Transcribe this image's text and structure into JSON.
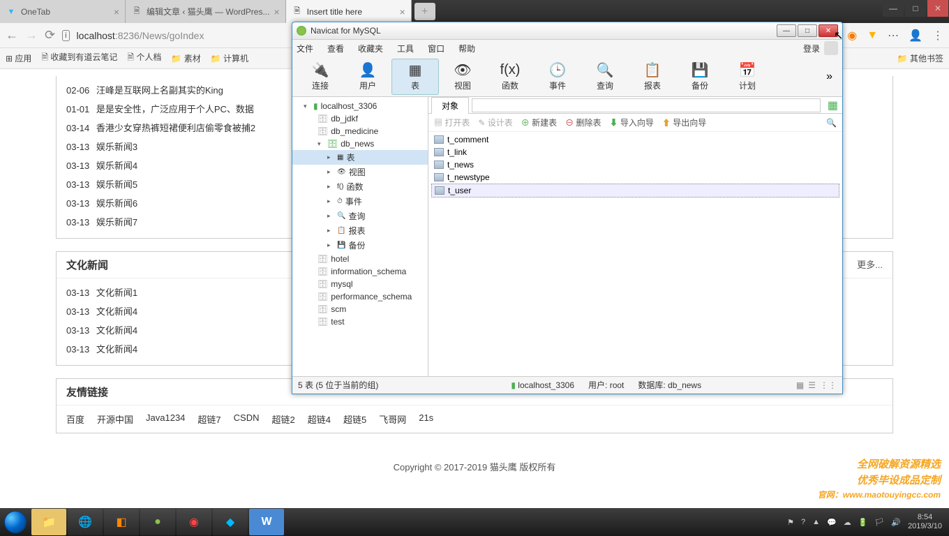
{
  "browser": {
    "tabs": [
      {
        "title": "OneTab",
        "favicon": "▼"
      },
      {
        "title": "编辑文章 ‹ 猫头鹰 — WordPres...",
        "favicon": "🗎"
      },
      {
        "title": "Insert title here",
        "favicon": "🗎"
      }
    ],
    "url_host": "localhost",
    "url_port": ":8236",
    "url_path": "/News/goIndex",
    "bookmarks": [
      "应用",
      "收藏到有道云笔记",
      "个人档",
      "素材",
      "计算机",
      "其他书签"
    ]
  },
  "page": {
    "news1": [
      {
        "date": "02-06",
        "title": "汪峰是互联网上名副其实的King"
      },
      {
        "date": "01-01",
        "title": "是是安全性，广泛应用于个人PC、数据"
      },
      {
        "date": "03-14",
        "title": "香港少女穿热裤短裙便利店偷零食被捕2"
      },
      {
        "date": "03-13",
        "title": "娱乐新闻3"
      },
      {
        "date": "03-13",
        "title": "娱乐新闻4"
      },
      {
        "date": "03-13",
        "title": "娱乐新闻5"
      },
      {
        "date": "03-13",
        "title": "娱乐新闻6"
      },
      {
        "date": "03-13",
        "title": "娱乐新闻7"
      }
    ],
    "section2_title": "文化新闻",
    "section2_more": "更多...",
    "news2": [
      {
        "date": "03-13",
        "title": "文化新闻1"
      },
      {
        "date": "03-13",
        "title": "文化新闻4"
      },
      {
        "date": "03-13",
        "title": "文化新闻4"
      },
      {
        "date": "03-13",
        "title": "文化新闻4"
      }
    ],
    "section3_title": "友情链接",
    "links": [
      "百度",
      "开源中国",
      "Java1234",
      "超链7",
      "CSDN",
      "超链2",
      "超链4",
      "超链5",
      "飞哥网",
      "21s"
    ],
    "copyright": "Copyright © 2017-2019 猫头鹰 版权所有"
  },
  "navicat": {
    "title": "Navicat for MySQL",
    "menu": [
      "文件",
      "查看",
      "收藏夹",
      "工具",
      "窗口",
      "帮助"
    ],
    "login": "登录",
    "toolbar": [
      {
        "label": "连接",
        "icon": "🔌"
      },
      {
        "label": "用户",
        "icon": "👤"
      },
      {
        "label": "表",
        "icon": "▦"
      },
      {
        "label": "视图",
        "icon": "👁"
      },
      {
        "label": "函数",
        "icon": "f(x)"
      },
      {
        "label": "事件",
        "icon": "🕒"
      },
      {
        "label": "查询",
        "icon": "🔍"
      },
      {
        "label": "报表",
        "icon": "📋"
      },
      {
        "label": "备份",
        "icon": "💾"
      },
      {
        "label": "计划",
        "icon": "📅"
      }
    ],
    "tree": {
      "conn": "localhost_3306",
      "dbs_top": [
        "db_jdkf",
        "db_medicine"
      ],
      "db_open": "db_news",
      "db_children": [
        "表",
        "视图",
        "函数",
        "事件",
        "查询",
        "报表",
        "备份"
      ],
      "dbs_bottom": [
        "hotel",
        "information_schema",
        "mysql",
        "performance_schema",
        "scm",
        "test"
      ]
    },
    "obj_tab": "对象",
    "obj_toolbar": {
      "open": "打开表",
      "design": "设计表",
      "new": "新建表",
      "delete": "删除表",
      "import": "导入向导",
      "export": "导出向导"
    },
    "tables": [
      "t_comment",
      "t_link",
      "t_news",
      "t_newstype",
      "t_user"
    ],
    "status": {
      "left": "5 表 (5 位于当前的组)",
      "conn": "localhost_3306",
      "user": "用户: root",
      "db": "数据库: db_news"
    }
  },
  "watermark": {
    "l1": "全网破解资源精选",
    "l2": "优秀毕设成品定制",
    "l3": "官网：www.maotouyingcc.com"
  },
  "tray": {
    "time": "8:54",
    "date": "2019/3/10"
  }
}
